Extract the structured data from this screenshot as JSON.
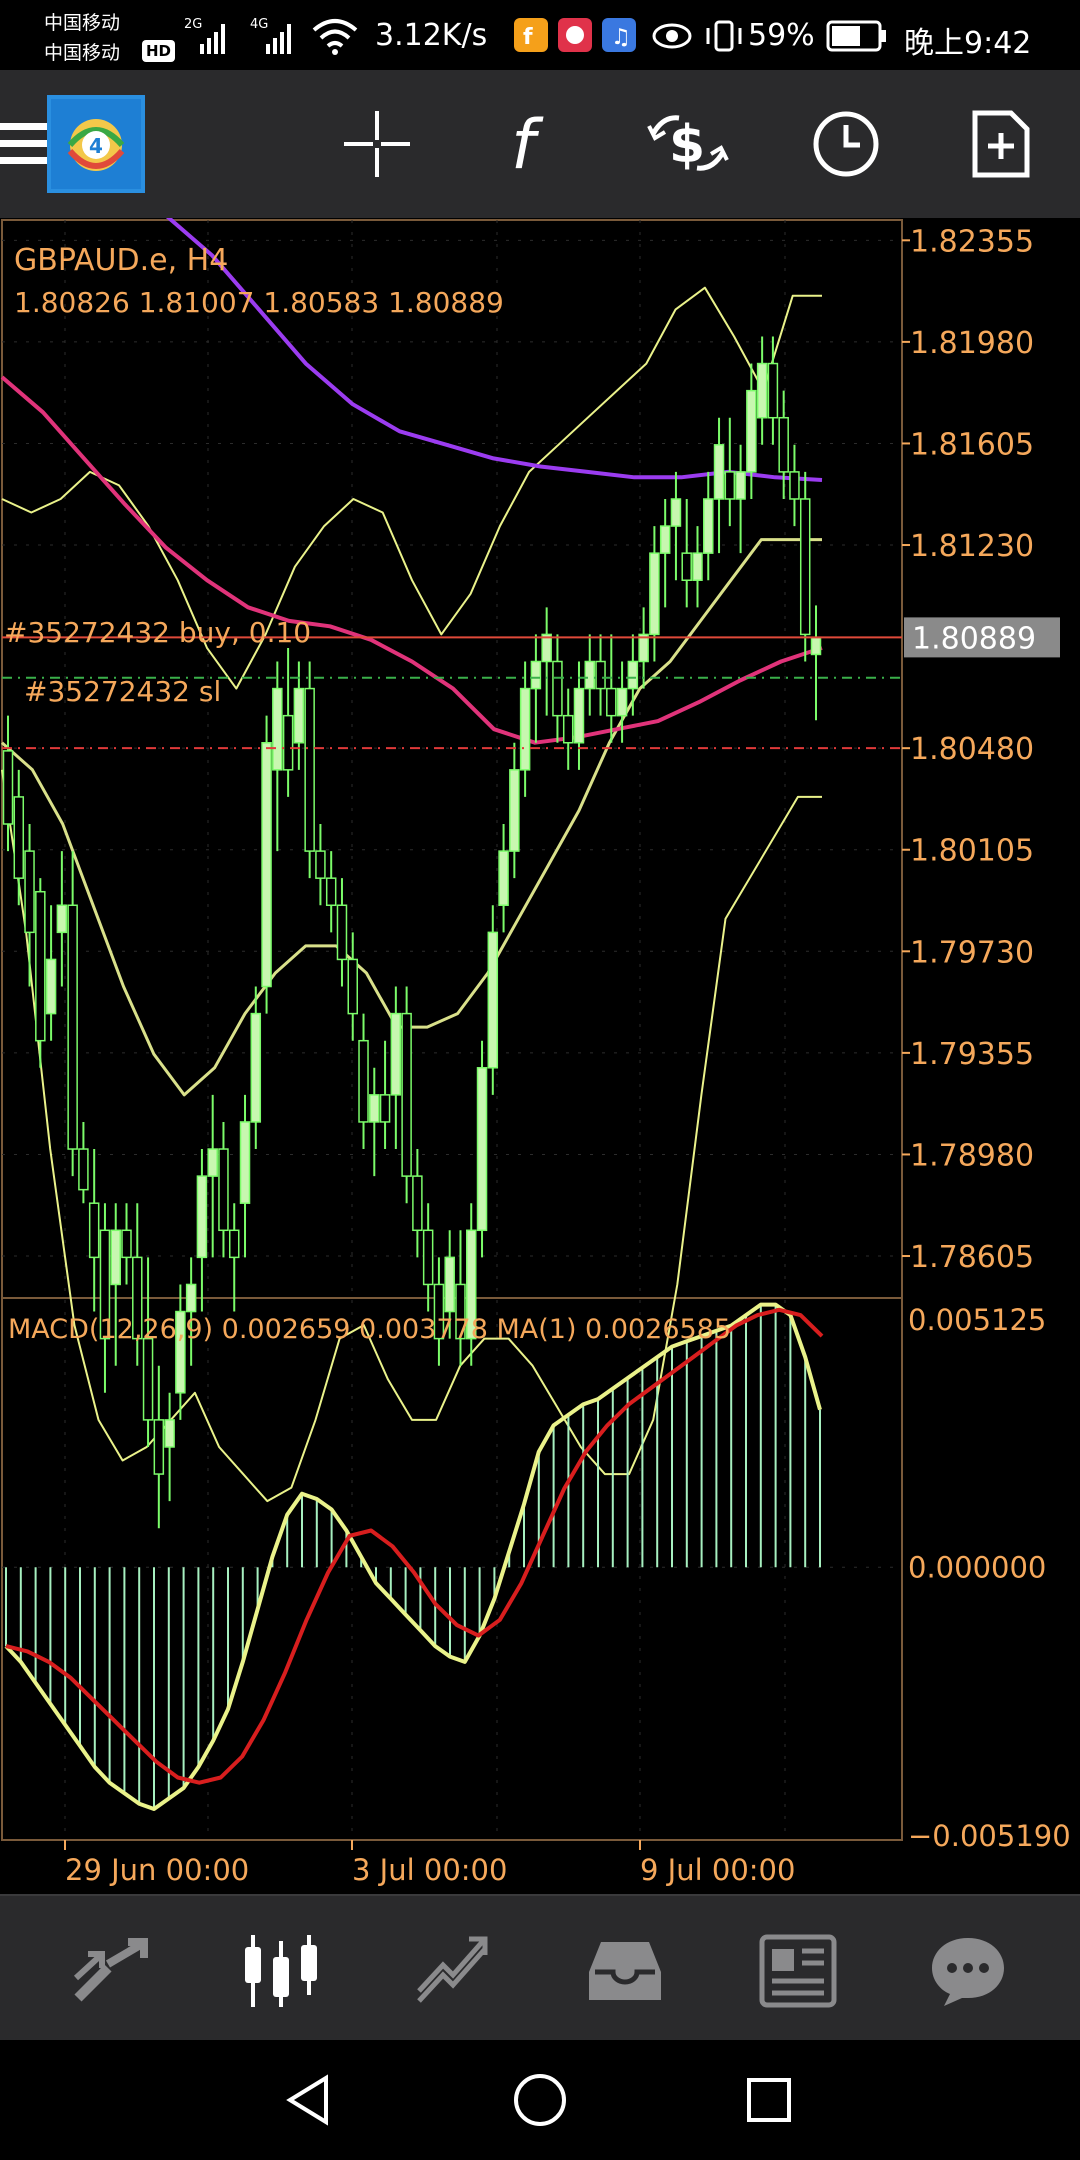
{
  "status_bar": {
    "carrier_1": "中国移动",
    "carrier_2": "中国移动",
    "hd_badge": "HD",
    "net_2g": "2G",
    "net_4g": "4G",
    "speed": "3.12K/s",
    "battery": "59%",
    "time": "晚上9:42"
  },
  "toolbar": {
    "icons": [
      "menu-icon",
      "app-logo",
      "crosshair-icon",
      "indicator-f-icon",
      "trade-dollar-icon",
      "timeframe-clock-icon",
      "new-order-icon"
    ],
    "function_label": "f"
  },
  "chart": {
    "symbol_title": "GBPAUD.e, H4",
    "ohlc": "1.80826 1.81007 1.80583 1.80889",
    "price_labels": [
      "1.82355",
      "1.81980",
      "1.81605",
      "1.81230",
      "1.80480",
      "1.80105",
      "1.79730",
      "1.79355",
      "1.78980",
      "1.78605"
    ],
    "current_price": "1.80889",
    "order_label": "#35272432 buy, 0.10",
    "sl_label": "#35272432 sl",
    "macd_title": "MACD(12,26,9) 0.002659 0.003778 MA(1) 0.0026585",
    "macd_labels": [
      "0.005125",
      "0.000000",
      "−0.005190"
    ],
    "time_labels": [
      "29 Jun 00:00",
      "3 Jul 00:00",
      "9 Jul 00:00"
    ],
    "colors": {
      "label": "#f5a85b",
      "bull": "#c8f7b0",
      "candle_outline": "#7cfc6a",
      "bollinger": "#eaf28a",
      "ma_purple": "#9b3cf0",
      "ma_pink": "#e0337a",
      "bid_line": "#e04a3a",
      "macd_signal": "#d81e1e",
      "macd_line": "#eaf28a",
      "hist": "#a7f0c0"
    }
  },
  "chart_data": {
    "type": "candlestick",
    "title": "GBPAUD.e, H4",
    "ylim": [
      1.7845,
      1.8243
    ],
    "current_price": 1.80889,
    "candles": [
      [
        1.8047,
        1.806,
        1.801,
        1.802
      ],
      [
        1.803,
        1.804,
        1.799,
        1.8
      ],
      [
        1.801,
        1.802,
        1.796,
        1.798
      ],
      [
        1.7995,
        1.8,
        1.793,
        1.794
      ],
      [
        1.795,
        1.799,
        1.794,
        1.797
      ],
      [
        1.798,
        1.801,
        1.796,
        1.799
      ],
      [
        1.799,
        1.801,
        1.789,
        1.79
      ],
      [
        1.79,
        1.791,
        1.788,
        1.7885
      ],
      [
        1.788,
        1.79,
        1.784,
        1.786
      ],
      [
        1.787,
        1.788,
        1.781,
        1.783
      ],
      [
        1.785,
        1.788,
        1.782,
        1.787
      ],
      [
        1.787,
        1.788,
        1.785,
        1.786
      ],
      [
        1.786,
        1.788,
        1.782,
        1.783
      ],
      [
        1.783,
        1.786,
        1.779,
        1.78
      ],
      [
        1.78,
        1.782,
        1.776,
        1.778
      ],
      [
        1.779,
        1.781,
        1.777,
        1.78
      ],
      [
        1.781,
        1.785,
        1.78,
        1.784
      ],
      [
        1.784,
        1.786,
        1.782,
        1.785
      ],
      [
        1.786,
        1.79,
        1.784,
        1.789
      ],
      [
        1.789,
        1.792,
        1.786,
        1.79
      ],
      [
        1.79,
        1.791,
        1.786,
        1.787
      ],
      [
        1.787,
        1.788,
        1.784,
        1.786
      ],
      [
        1.788,
        1.792,
        1.786,
        1.791
      ],
      [
        1.791,
        1.796,
        1.79,
        1.795
      ],
      [
        1.796,
        1.806,
        1.795,
        1.805
      ],
      [
        1.804,
        1.808,
        1.801,
        1.807
      ],
      [
        1.806,
        1.8085,
        1.803,
        1.804
      ],
      [
        1.805,
        1.808,
        1.804,
        1.807
      ],
      [
        1.807,
        1.808,
        1.8,
        1.801
      ],
      [
        1.801,
        1.802,
        1.799,
        1.8
      ],
      [
        1.8,
        1.801,
        1.798,
        1.799
      ],
      [
        1.799,
        1.8,
        1.796,
        1.797
      ],
      [
        1.797,
        1.798,
        1.794,
        1.795
      ],
      [
        1.794,
        1.795,
        1.79,
        1.791
      ],
      [
        1.791,
        1.793,
        1.789,
        1.792
      ],
      [
        1.792,
        1.794,
        1.79,
        1.791
      ],
      [
        1.792,
        1.796,
        1.79,
        1.795
      ],
      [
        1.795,
        1.796,
        1.788,
        1.789
      ],
      [
        1.789,
        1.79,
        1.786,
        1.787
      ],
      [
        1.787,
        1.788,
        1.784,
        1.785
      ],
      [
        1.785,
        1.786,
        1.782,
        1.783
      ],
      [
        1.784,
        1.787,
        1.783,
        1.786
      ],
      [
        1.785,
        1.787,
        1.782,
        1.783
      ],
      [
        1.783,
        1.788,
        1.782,
        1.787
      ],
      [
        1.787,
        1.794,
        1.786,
        1.793
      ],
      [
        1.793,
        1.799,
        1.792,
        1.798
      ],
      [
        1.799,
        1.802,
        1.798,
        1.801
      ],
      [
        1.801,
        1.805,
        1.8,
        1.804
      ],
      [
        1.804,
        1.808,
        1.803,
        1.807
      ],
      [
        1.807,
        1.809,
        1.805,
        1.808
      ],
      [
        1.808,
        1.81,
        1.806,
        1.809
      ],
      [
        1.808,
        1.809,
        1.805,
        1.806
      ],
      [
        1.806,
        1.807,
        1.804,
        1.805
      ],
      [
        1.805,
        1.808,
        1.804,
        1.807
      ],
      [
        1.807,
        1.809,
        1.806,
        1.808
      ],
      [
        1.808,
        1.809,
        1.806,
        1.807
      ],
      [
        1.807,
        1.809,
        1.805,
        1.806
      ],
      [
        1.806,
        1.808,
        1.805,
        1.807
      ],
      [
        1.807,
        1.809,
        1.806,
        1.808
      ],
      [
        1.808,
        1.81,
        1.807,
        1.809
      ],
      [
        1.809,
        1.813,
        1.808,
        1.812
      ],
      [
        1.812,
        1.814,
        1.81,
        1.813
      ],
      [
        1.813,
        1.815,
        1.811,
        1.814
      ],
      [
        1.812,
        1.814,
        1.81,
        1.811
      ],
      [
        1.811,
        1.813,
        1.81,
        1.812
      ],
      [
        1.812,
        1.815,
        1.811,
        1.814
      ],
      [
        1.814,
        1.817,
        1.812,
        1.816
      ],
      [
        1.815,
        1.817,
        1.813,
        1.814
      ],
      [
        1.814,
        1.816,
        1.812,
        1.815
      ],
      [
        1.815,
        1.819,
        1.814,
        1.818
      ],
      [
        1.817,
        1.82,
        1.816,
        1.819
      ],
      [
        1.819,
        1.82,
        1.816,
        1.817
      ],
      [
        1.817,
        1.818,
        1.814,
        1.815
      ],
      [
        1.815,
        1.816,
        1.813,
        1.814
      ],
      [
        1.814,
        1.815,
        1.808,
        1.809
      ],
      [
        1.80826,
        1.81007,
        1.80583,
        1.80889
      ]
    ],
    "bb_upper": [
      1.814,
      1.8135,
      1.814,
      1.815,
      1.8145,
      1.813,
      1.811,
      1.8085,
      1.807,
      1.809,
      1.8115,
      1.813,
      1.814,
      1.8135,
      1.811,
      1.809,
      1.8105,
      1.813,
      1.815,
      1.816,
      1.817,
      1.818,
      1.819,
      1.821,
      1.8218,
      1.82,
      1.818,
      1.8215,
      1.8215
    ],
    "bb_mid": [
      1.805,
      1.804,
      1.802,
      1.799,
      1.796,
      1.7935,
      1.792,
      1.793,
      1.795,
      1.7965,
      1.7975,
      1.7975,
      1.7965,
      1.7945,
      1.7945,
      1.795,
      1.7965,
      1.7985,
      1.8005,
      1.8025,
      1.805,
      1.807,
      1.808,
      1.8095,
      1.811,
      1.8125,
      1.8125,
      1.8125
    ],
    "bb_lower": [
      1.804,
      1.798,
      1.79,
      1.7835,
      1.78,
      1.7785,
      1.779,
      1.78,
      1.781,
      1.779,
      1.778,
      1.777,
      1.7775,
      1.78,
      1.783,
      1.7835,
      1.7815,
      1.78,
      1.78,
      1.782,
      1.783,
      1.783,
      1.782,
      1.7805,
      1.779,
      1.778,
      1.778,
      1.78,
      1.785,
      1.792,
      1.7985,
      1.8,
      1.8015,
      1.803,
      1.803
    ],
    "ma_purple": [
      1.8245,
      1.823,
      1.821,
      1.819,
      1.8175,
      1.8165,
      1.816,
      1.8155,
      1.8152,
      1.815,
      1.8148,
      1.8148,
      1.815,
      1.8148,
      1.8147
    ],
    "ma_pink": [
      1.8185,
      1.8172,
      1.8155,
      1.8138,
      1.8122,
      1.811,
      1.81,
      1.8095,
      1.8093,
      1.8088,
      1.808,
      1.807,
      1.8055,
      1.805,
      1.8052,
      1.8055,
      1.8058,
      1.8065,
      1.8073,
      1.808,
      1.8085
    ],
    "macd": {
      "ylim": [
        -0.00519,
        0.005125
      ],
      "histogram": [
        -0.0015,
        -0.0018,
        -0.0022,
        -0.0026,
        -0.003,
        -0.0034,
        -0.0038,
        -0.0041,
        -0.0043,
        -0.0045,
        -0.0046,
        -0.0044,
        -0.0042,
        -0.0038,
        -0.0033,
        -0.0027,
        -0.0018,
        -0.0008,
        0.0002,
        0.001,
        0.0014,
        0.0013,
        0.0011,
        0.0007,
        0.0002,
        -0.0003,
        -0.0006,
        -0.0009,
        -0.0012,
        -0.0015,
        -0.0017,
        -0.0018,
        -0.0013,
        -0.0006,
        0.0003,
        0.0012,
        0.0022,
        0.0027,
        0.0029,
        0.0031,
        0.0032,
        0.0034,
        0.0036,
        0.0038,
        0.004,
        0.0042,
        0.0043,
        0.0044,
        0.0045,
        0.0046,
        0.0048,
        0.005,
        0.005,
        0.0048,
        0.004,
        0.003
      ],
      "signal": [
        -0.0015,
        -0.0016,
        -0.0018,
        -0.0021,
        -0.0025,
        -0.0029,
        -0.0033,
        -0.0037,
        -0.004,
        -0.0041,
        -0.004,
        -0.0036,
        -0.0029,
        -0.002,
        -0.001,
        -0.0001,
        0.0006,
        0.0007,
        0.0004,
        -0.0001,
        -0.0007,
        -0.0011,
        -0.0013,
        -0.001,
        -0.0003,
        0.0006,
        0.0015,
        0.0022,
        0.0027,
        0.0031,
        0.0034,
        0.0037,
        0.004,
        0.0043,
        0.0046,
        0.0048,
        0.0049,
        0.0048,
        0.0044
      ]
    },
    "time_ticks": [
      "29 Jun 00:00",
      "3 Jul 00:00",
      "9 Jul 00:00"
    ]
  },
  "bottom_nav": {
    "items": [
      "quotes-icon",
      "chart-icon",
      "trade-icon",
      "history-icon",
      "news-icon",
      "chat-icon"
    ]
  }
}
